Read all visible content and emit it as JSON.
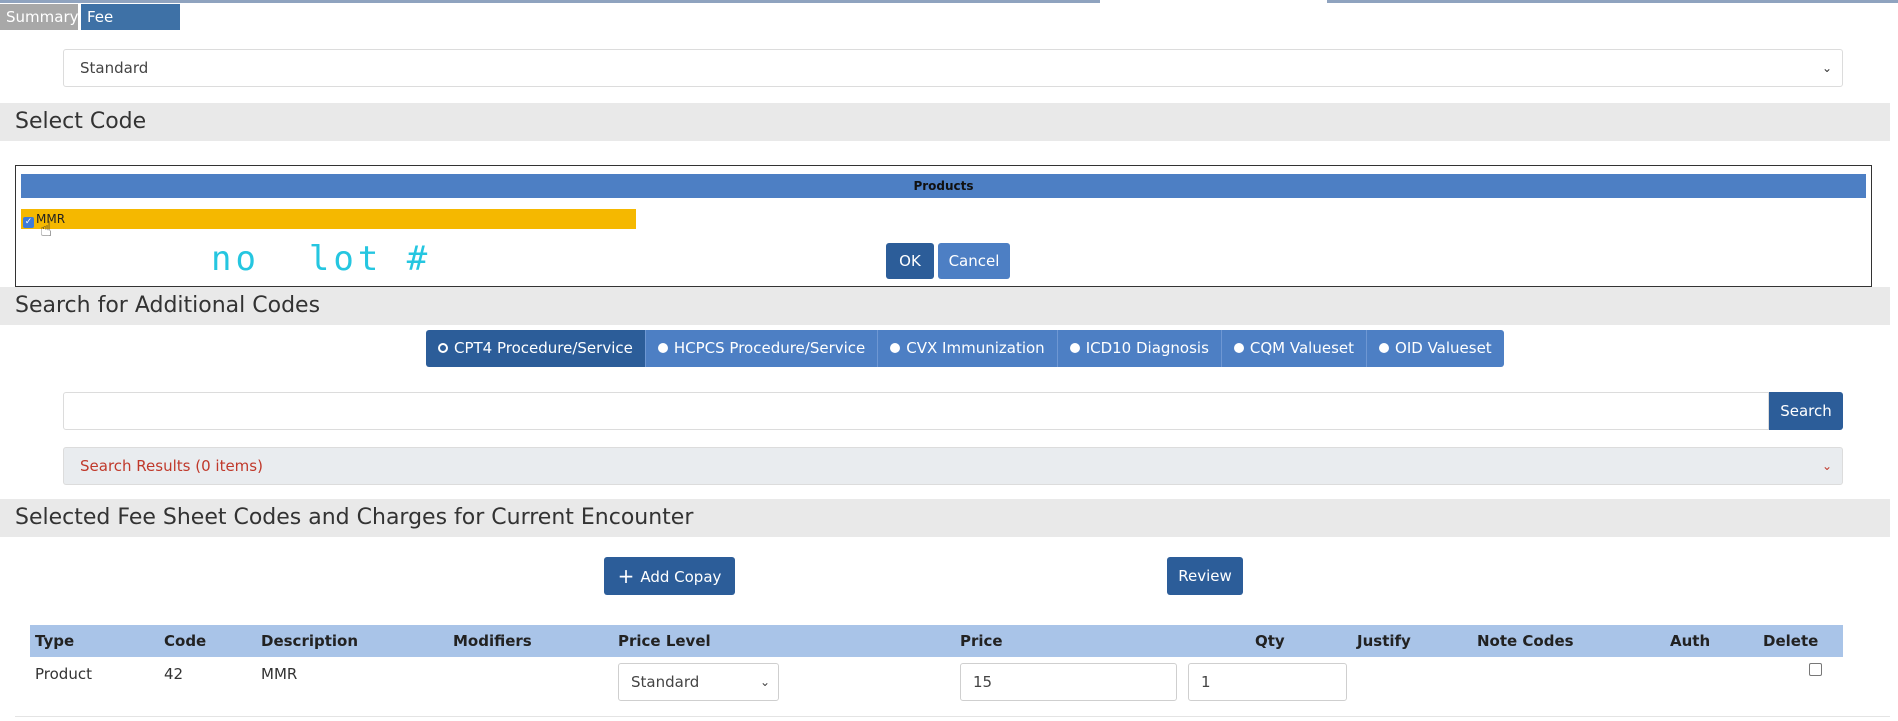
{
  "tabs": {
    "summary": "Summary",
    "fee_sheet": "Fee Sheet",
    "close": "×"
  },
  "price_level_top": {
    "value": "Standard"
  },
  "select_code": {
    "title": "Select Code",
    "products_header": "Products",
    "product_item": "MMR",
    "product_checked": true,
    "handwritten_note": "no  lot #",
    "ok_label": "OK",
    "cancel_label": "Cancel"
  },
  "search": {
    "title": "Search for Additional Codes",
    "options": [
      {
        "label": "CPT4 Procedure/Service",
        "selected": true
      },
      {
        "label": "HCPCS Procedure/Service",
        "selected": false
      },
      {
        "label": "CVX Immunization",
        "selected": false
      },
      {
        "label": "ICD10 Diagnosis",
        "selected": false
      },
      {
        "label": "CQM Valueset",
        "selected": false
      },
      {
        "label": "OID Valueset",
        "selected": false
      }
    ],
    "input_value": "",
    "search_label": "Search",
    "results_label": "Search Results (0 items)"
  },
  "selected": {
    "title": "Selected Fee Sheet Codes and Charges for Current Encounter",
    "add_copay_label": "Add Copay",
    "review_label": "Review",
    "columns": [
      "Type",
      "Code",
      "Description",
      "Modifiers",
      "Price Level",
      "Price",
      "Qty",
      "Justify",
      "Note Codes",
      "Auth",
      "Delete"
    ],
    "rows": [
      {
        "type": "Product",
        "code": "42",
        "description": "MMR",
        "price_level": "Standard",
        "price": "15",
        "qty": "1"
      }
    ]
  },
  "colors": {
    "primary": "#2c5d99",
    "accent": "#4d7fc4",
    "highlight": "#f5b800",
    "handwriting": "#25c6e0"
  }
}
